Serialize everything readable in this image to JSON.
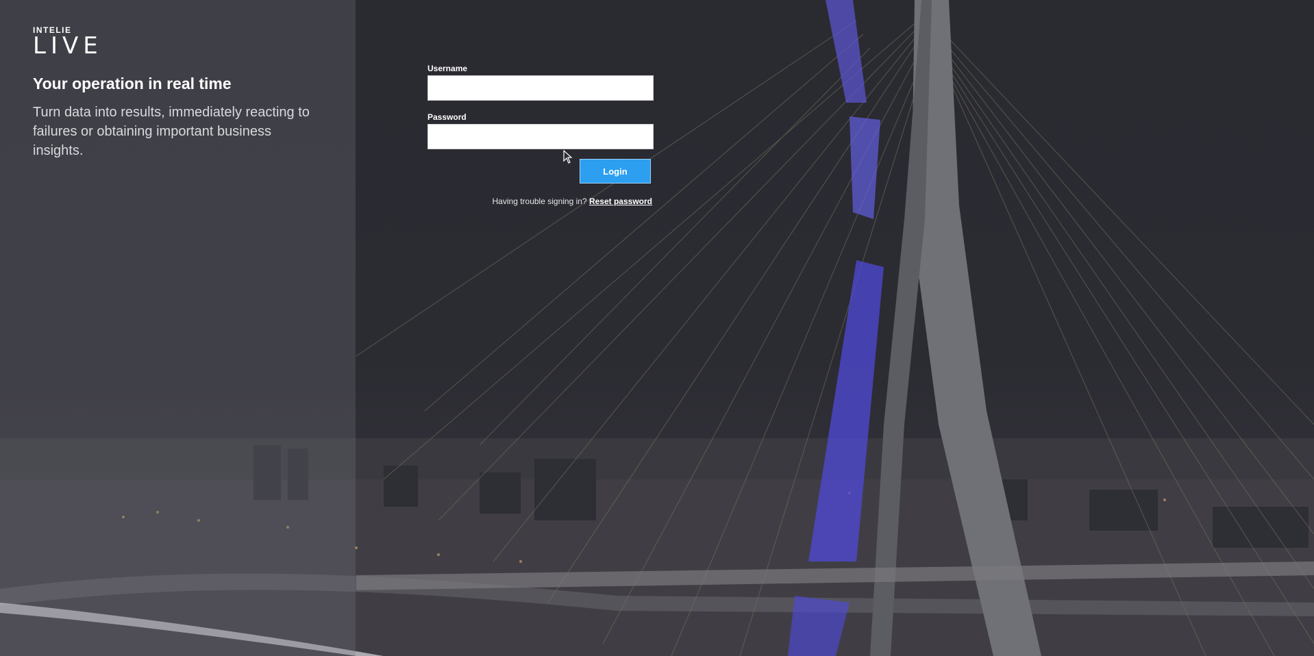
{
  "brand": {
    "logo_top": "INTELIE",
    "logo_main": "LIVE"
  },
  "intro": {
    "headline": "Your operation in real time",
    "tagline": "Turn data into results, immediately reacting to failures or obtaining important business insights."
  },
  "login": {
    "username_label": "Username",
    "username_value": "",
    "password_label": "Password",
    "password_value": "",
    "login_button": "Login",
    "help_text": "Having trouble signing in?",
    "reset_link": "Reset password"
  },
  "colors": {
    "accent": "#2d9ff0",
    "background": "#2a2a31",
    "panel": "rgba(120,120,128,0.28)"
  }
}
